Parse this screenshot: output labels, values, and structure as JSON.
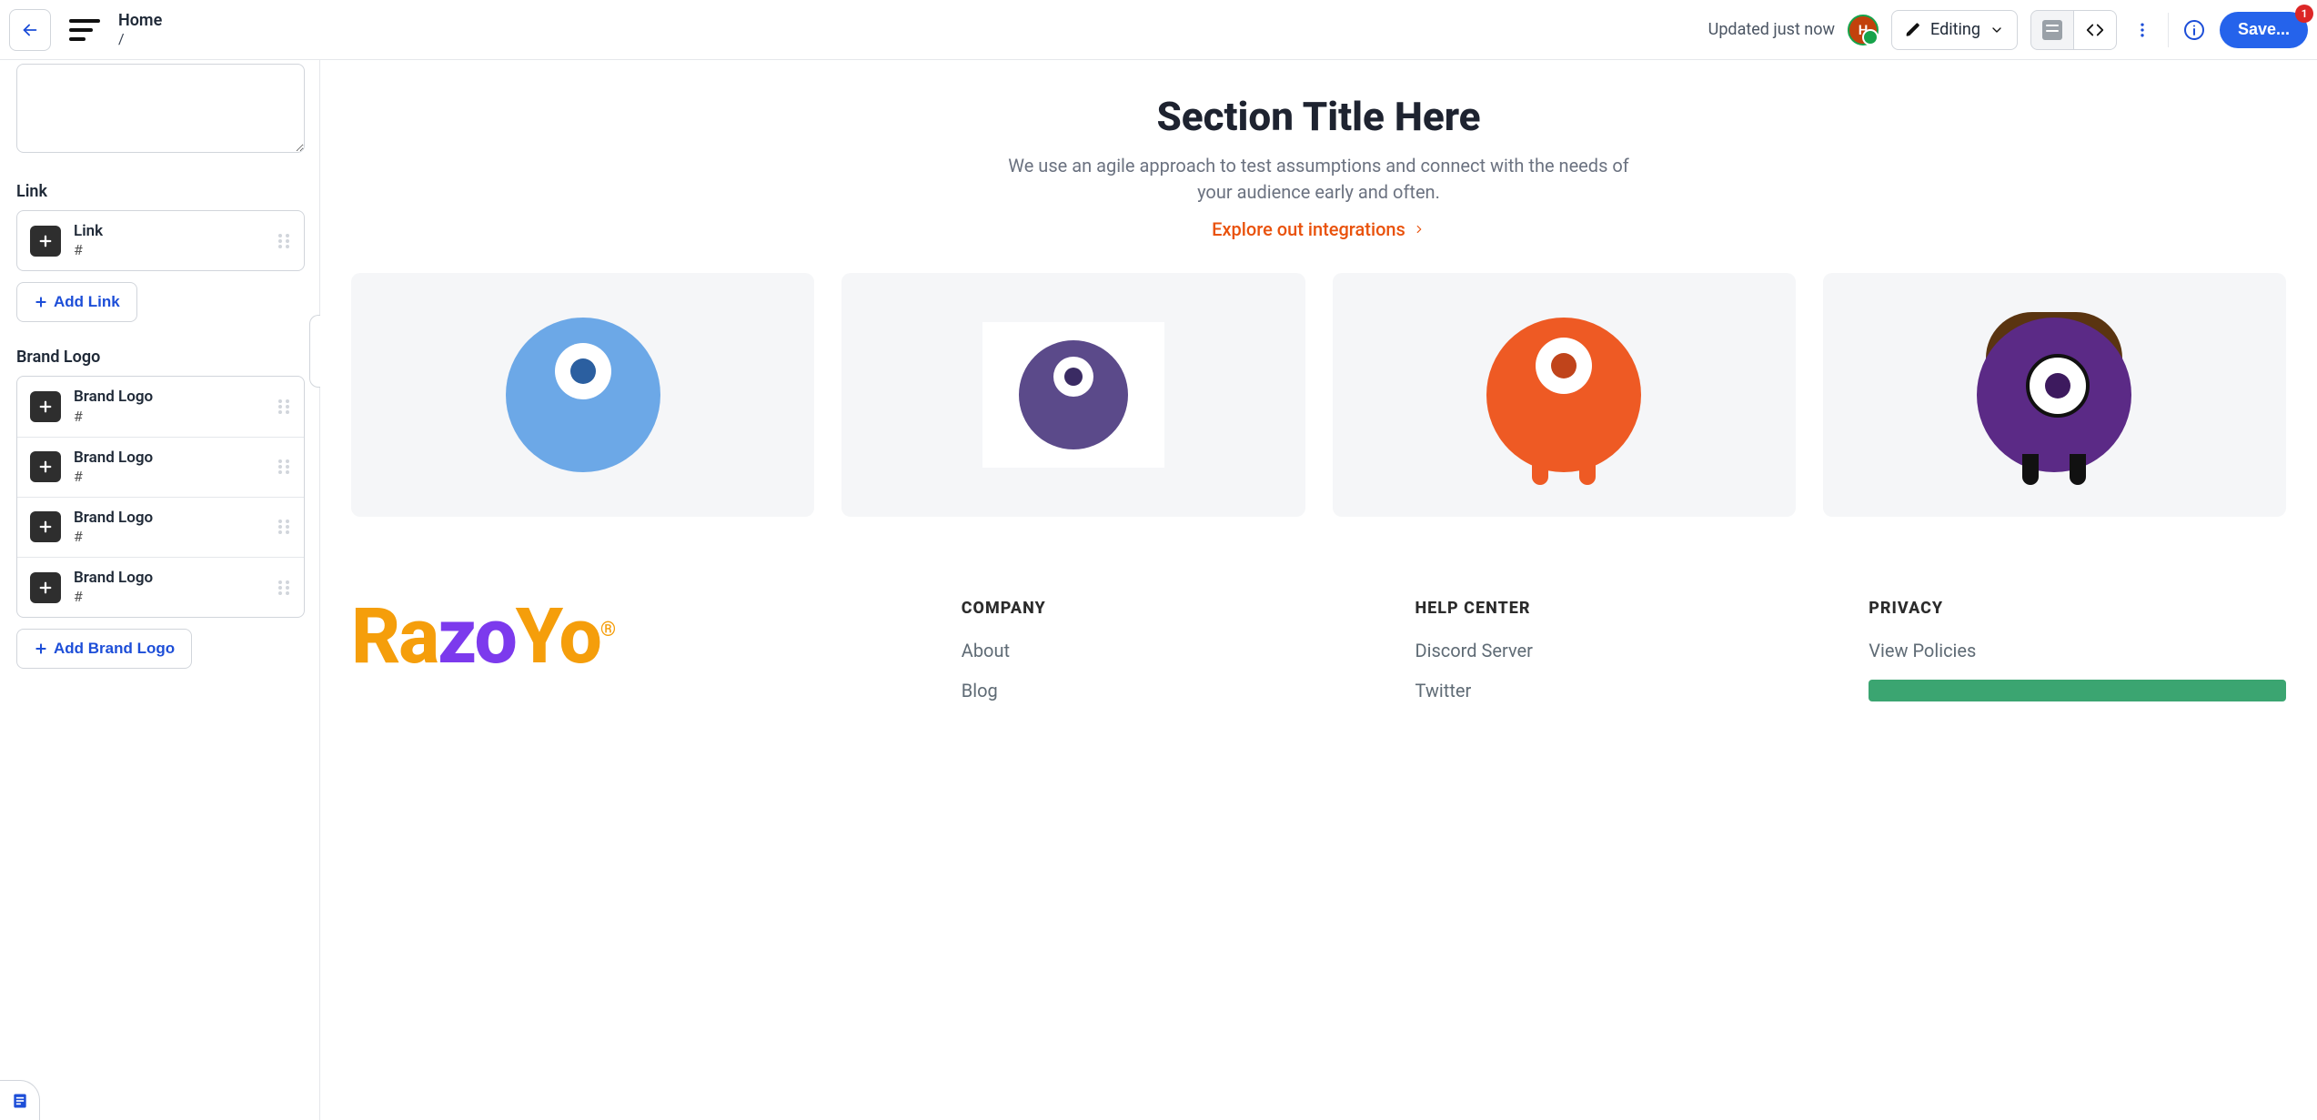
{
  "topbar": {
    "page_title": "Home",
    "page_path": "/",
    "status": "Updated just now",
    "avatar_initial": "H",
    "mode_label": "Editing",
    "save_label": "Save...",
    "save_badge": "1"
  },
  "sidebar": {
    "link_section_label": "Link",
    "link_items": [
      {
        "title": "Link",
        "sub": "#"
      }
    ],
    "add_link_label": "Add Link",
    "brand_section_label": "Brand Logo",
    "brand_items": [
      {
        "title": "Brand Logo",
        "sub": "#"
      },
      {
        "title": "Brand Logo",
        "sub": "#"
      },
      {
        "title": "Brand Logo",
        "sub": "#"
      },
      {
        "title": "Brand Logo",
        "sub": "#"
      }
    ],
    "add_brand_label": "Add Brand Logo"
  },
  "hero": {
    "title": "Section Title Here",
    "subtitle": "We use an agile approach to test assumptions and connect with the needs of your audience early and often.",
    "cta": "Explore out integrations"
  },
  "footer": {
    "logo_text": "Razoyo",
    "columns": {
      "company": {
        "heading": "COMPANY",
        "links": [
          "About",
          "Blog"
        ]
      },
      "help": {
        "heading": "HELP CENTER",
        "links": [
          "Discord Server",
          "Twitter"
        ]
      },
      "privacy": {
        "heading": "PRIVACY",
        "links": [
          "View Policies"
        ]
      }
    }
  }
}
